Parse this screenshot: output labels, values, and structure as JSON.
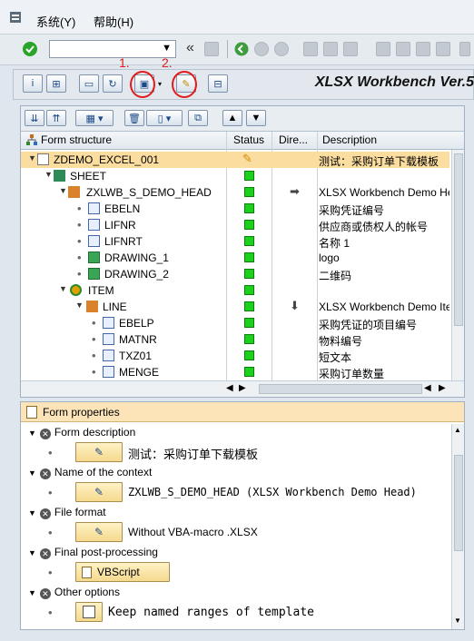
{
  "menu": {
    "system": "系统(Y)",
    "help": "帮助(H)"
  },
  "toolbar": {
    "nav_back": "«"
  },
  "app": {
    "title": "XLSX Workbench Ver.5"
  },
  "annotations": {
    "label1": "1.",
    "label2": "2."
  },
  "tree": {
    "columns": {
      "structure": "Form structure",
      "status": "Status",
      "direction": "Dire...",
      "description": "Description"
    },
    "rows": [
      {
        "name": "ZDEMO_EXCEL_001",
        "desc": "测试：采购订单下载模板"
      },
      {
        "name": "SHEET",
        "desc": ""
      },
      {
        "name": "ZXLWB_S_DEMO_HEAD",
        "desc": "XLSX Workbench Demo Head"
      },
      {
        "name": "EBELN",
        "desc": "采购凭证编号"
      },
      {
        "name": "LIFNR",
        "desc": "供应商或债权人的帐号"
      },
      {
        "name": "LIFNRT",
        "desc": "名称 1"
      },
      {
        "name": "DRAWING_1",
        "desc": "logo"
      },
      {
        "name": "DRAWING_2",
        "desc": "二维码"
      },
      {
        "name": "ITEM",
        "desc": ""
      },
      {
        "name": "LINE",
        "desc": "XLSX Workbench Demo Item"
      },
      {
        "name": "EBELP",
        "desc": "采购凭证的项目编号"
      },
      {
        "name": "MATNR",
        "desc": "物料编号"
      },
      {
        "name": "TXZ01",
        "desc": "短文本"
      },
      {
        "name": "MENGE",
        "desc": "采购订单数量"
      }
    ]
  },
  "props": {
    "header": "Form properties",
    "form_description": "Form description",
    "form_description_value": "测试：采购订单下载模板",
    "context": "Name of the context",
    "context_value": "ZXLWB_S_DEMO_HEAD  (XLSX Workbench Demo Head)",
    "file_format": "File format",
    "file_format_value": "Without VBA-macro .XLSX",
    "post_processing": "Final post-processing",
    "post_processing_button": "VBScript",
    "other_options": "Other options",
    "keep_named_ranges": "Keep named ranges of template"
  },
  "colors": {
    "status_ok": "#1bd11b",
    "selected_row": "#fcdda0",
    "annotation": "#e01c1c"
  }
}
